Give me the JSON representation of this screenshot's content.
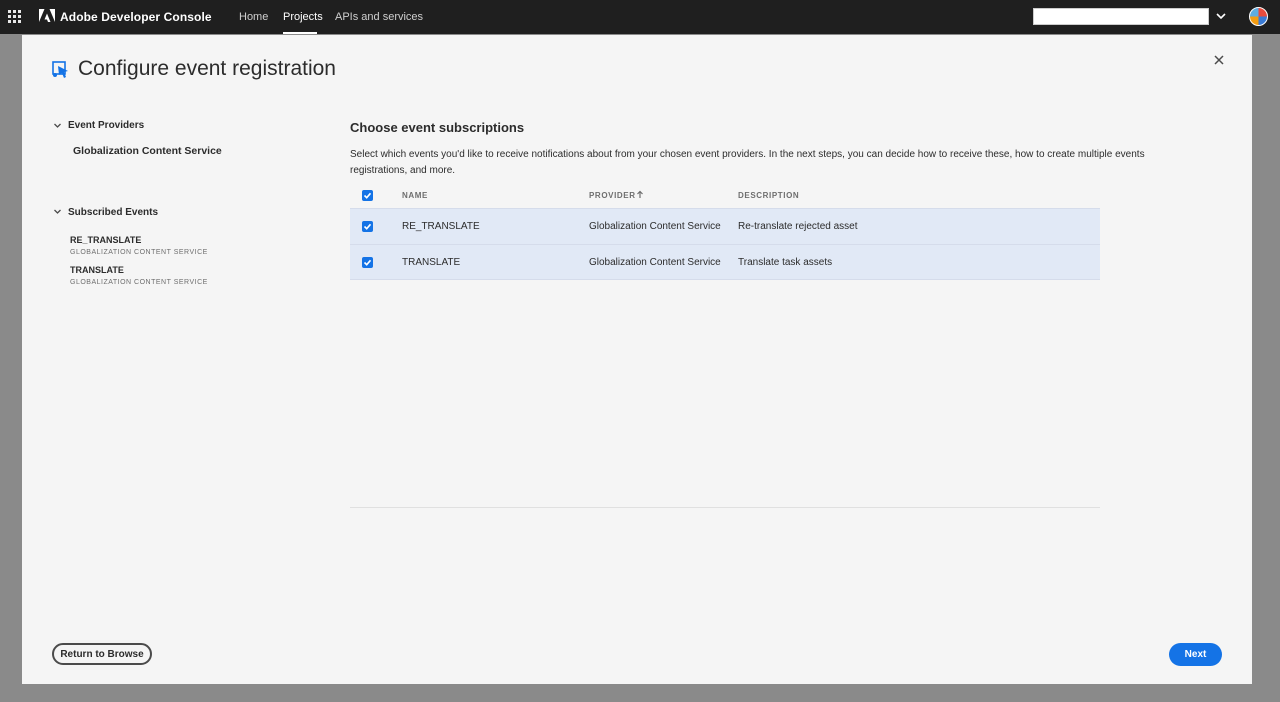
{
  "header": {
    "brand": "Adobe Developer Console",
    "nav": [
      {
        "label": "Home",
        "active": false
      },
      {
        "label": "Projects",
        "active": true
      },
      {
        "label": "APIs and services",
        "active": false
      }
    ],
    "search_value": ""
  },
  "modal": {
    "title": "Configure event registration",
    "sidebar": {
      "providers_heading": "Event Providers",
      "providers": [
        "Globalization Content Service"
      ],
      "subscribed_heading": "Subscribed Events",
      "events": [
        {
          "name": "RE_TRANSLATE",
          "provider": "GLOBALIZATION CONTENT SERVICE"
        },
        {
          "name": "TRANSLATE",
          "provider": "GLOBALIZATION CONTENT SERVICE"
        }
      ]
    },
    "main": {
      "title": "Choose event subscriptions",
      "description": "Select which events you'd like to receive notifications about from your chosen event providers. In the next steps, you can decide how to receive these, how to create multiple events registrations, and more.",
      "columns": {
        "name": "NAME",
        "provider": "PROVIDER",
        "description": "DESCRIPTION"
      },
      "rows": [
        {
          "name": "RE_TRANSLATE",
          "provider": "Globalization Content Service",
          "description": "Re-translate rejected asset",
          "checked": true
        },
        {
          "name": "TRANSLATE",
          "provider": "Globalization Content Service",
          "description": "Translate task assets",
          "checked": true
        }
      ]
    },
    "footer": {
      "return_label": "Return to Browse",
      "next_label": "Next"
    }
  },
  "colors": {
    "accent": "#1473e6",
    "topbar": "#1f1f1f",
    "row_selected": "#e1e9f6"
  }
}
